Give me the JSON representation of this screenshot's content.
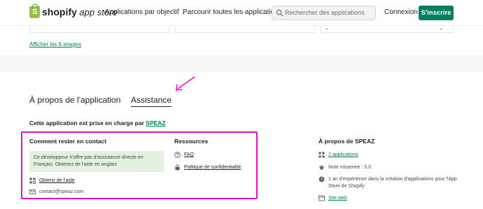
{
  "header": {
    "logo_bold": "shopify",
    "logo_italic": " app store",
    "nav_by_objective": "Applications par objectif",
    "nav_browse_all": "Parcourir toutes les applications",
    "search_placeholder": "Rechercher des applications",
    "login": "Connexion",
    "signup": "S'inscrire"
  },
  "gallery": {
    "show_images": "Afficher les 6 images"
  },
  "tabs": {
    "about": "À propos de l'application",
    "support": "Assistance"
  },
  "support": {
    "supported_by_prefix": "Cette application est prise en charge par ",
    "supported_by_name": "SPEAZ",
    "contact_title": "Comment rester en contact",
    "notice": "Ce développeur n'offre pas d'assistance directe en Français. Obtenez de l'aide en anglais",
    "get_help": "Obtenir de l'aide",
    "email": "contact@speaz.com",
    "resources_title": "Ressources",
    "faq": "FAQ",
    "privacy": "Politique de confidentialité"
  },
  "developer": {
    "title": "À propos de SPEAZ",
    "apps": "2 applications",
    "rating": "Note moyenne : 5.0",
    "experience": "1 an d'expérience dans la création d'applications pour l'App Store de Shopify",
    "website": "Site web"
  },
  "colors": {
    "accent": "#008060",
    "highlight": "#e010c8",
    "notice_bg": "#e3f1df"
  }
}
